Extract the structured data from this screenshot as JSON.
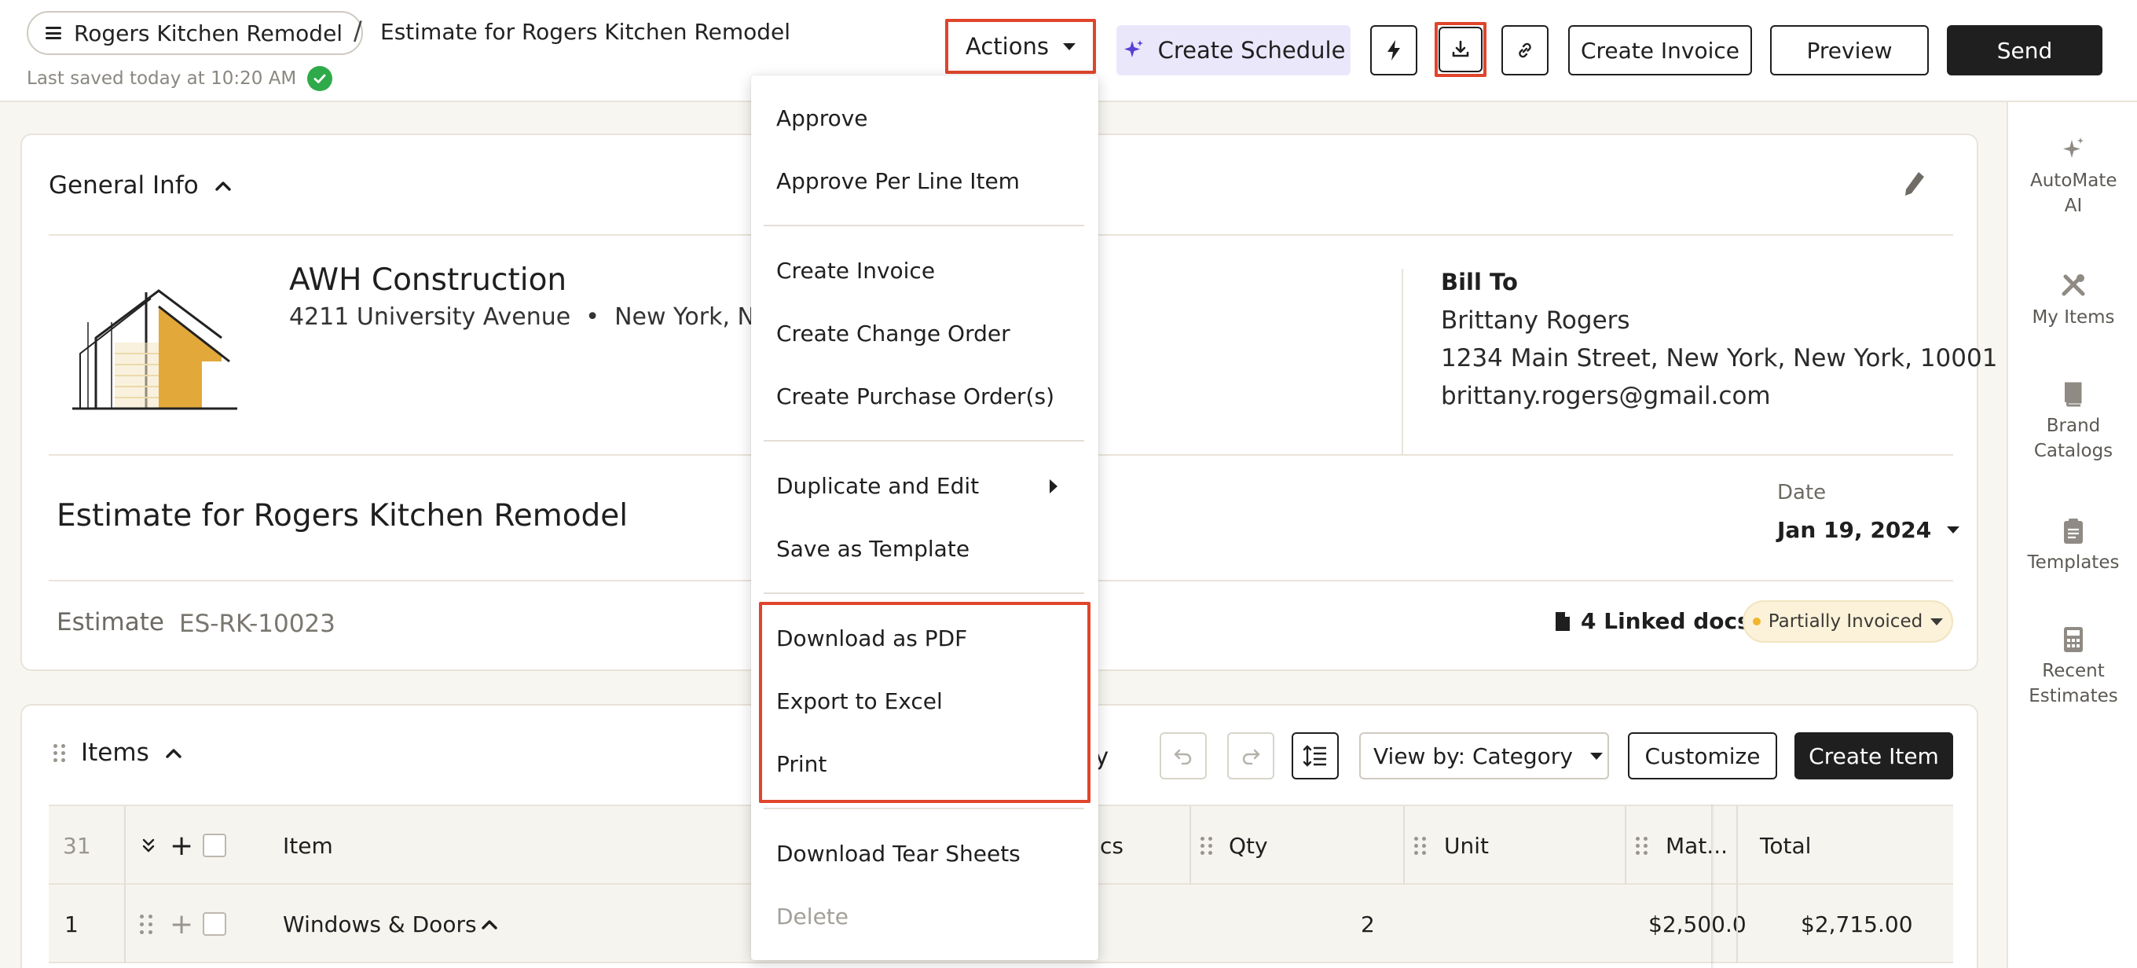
{
  "header": {
    "project_name": "Rogers Kitchen Remodel",
    "separator": "/",
    "document_title": "Estimate for Rogers Kitchen Remodel",
    "last_saved": "Last saved today at 10:20 AM",
    "actions_label": "Actions",
    "create_schedule_label": "Create Schedule",
    "create_invoice_label": "Create Invoice",
    "preview_label": "Preview",
    "send_label": "Send"
  },
  "right_rail": {
    "items": [
      {
        "label": "AutoMate AI",
        "icon": "sparkle-icon"
      },
      {
        "label": "My Items",
        "icon": "tools-icon"
      },
      {
        "label": "Brand Catalogs",
        "icon": "book-icon"
      },
      {
        "label": "Templates",
        "icon": "clipboard-icon"
      },
      {
        "label": "Recent Estimates",
        "icon": "calculator-icon"
      }
    ]
  },
  "general_info": {
    "title": "General Info",
    "company_name": "AWH Construction",
    "company_address": "4211 University Avenue",
    "company_bullet": "•",
    "company_city": "New York, New",
    "bill_to_label": "Bill To",
    "bill_to_name": "Brittany Rogers",
    "bill_to_address": "1234 Main Street, New York, New York, 10001",
    "bill_to_email": "brittany.rogers@gmail.com",
    "estimate_title": "Estimate for Rogers Kitchen Remodel",
    "date_label": "Date",
    "date_value": "Jan 19, 2024",
    "estimate_label": "Estimate",
    "estimate_number": "ES-RK-10023",
    "linked_docs": "4 Linked docs",
    "status": "Partially Invoiced",
    "accent_color": "#e3a83a"
  },
  "items_section": {
    "title": "Items",
    "ply_fragment": "ply",
    "view_by": "View by: Category",
    "customize_label": "Customize",
    "create_item_label": "Create Item",
    "columns": {
      "count": "31",
      "item": "Item",
      "docs_fragment": "cs",
      "qty": "Qty",
      "unit": "Unit",
      "material": "Mat...",
      "total": "Total"
    },
    "rows": [
      {
        "index": "1",
        "name": "Windows & Doors",
        "qty": "2",
        "unit": "",
        "material": "$2,500.0",
        "total": "$2,715.00"
      }
    ]
  },
  "actions_menu": {
    "items": [
      {
        "label": "Approve"
      },
      {
        "label": "Approve Per Line Item"
      },
      {
        "label": "Create Invoice"
      },
      {
        "label": "Create Change Order"
      },
      {
        "label": "Create Purchase Order(s)"
      },
      {
        "label": "Duplicate and Edit"
      },
      {
        "label": "Save as Template"
      },
      {
        "label": "Download as PDF"
      },
      {
        "label": "Export to Excel"
      },
      {
        "label": "Print"
      },
      {
        "label": "Download Tear Sheets"
      },
      {
        "label": "Delete"
      }
    ]
  },
  "colors": {
    "highlight": "#e0452b",
    "primary_dark": "#1f1f1f",
    "schedule_bg": "#ebe7fb",
    "success": "#2faa4a"
  }
}
